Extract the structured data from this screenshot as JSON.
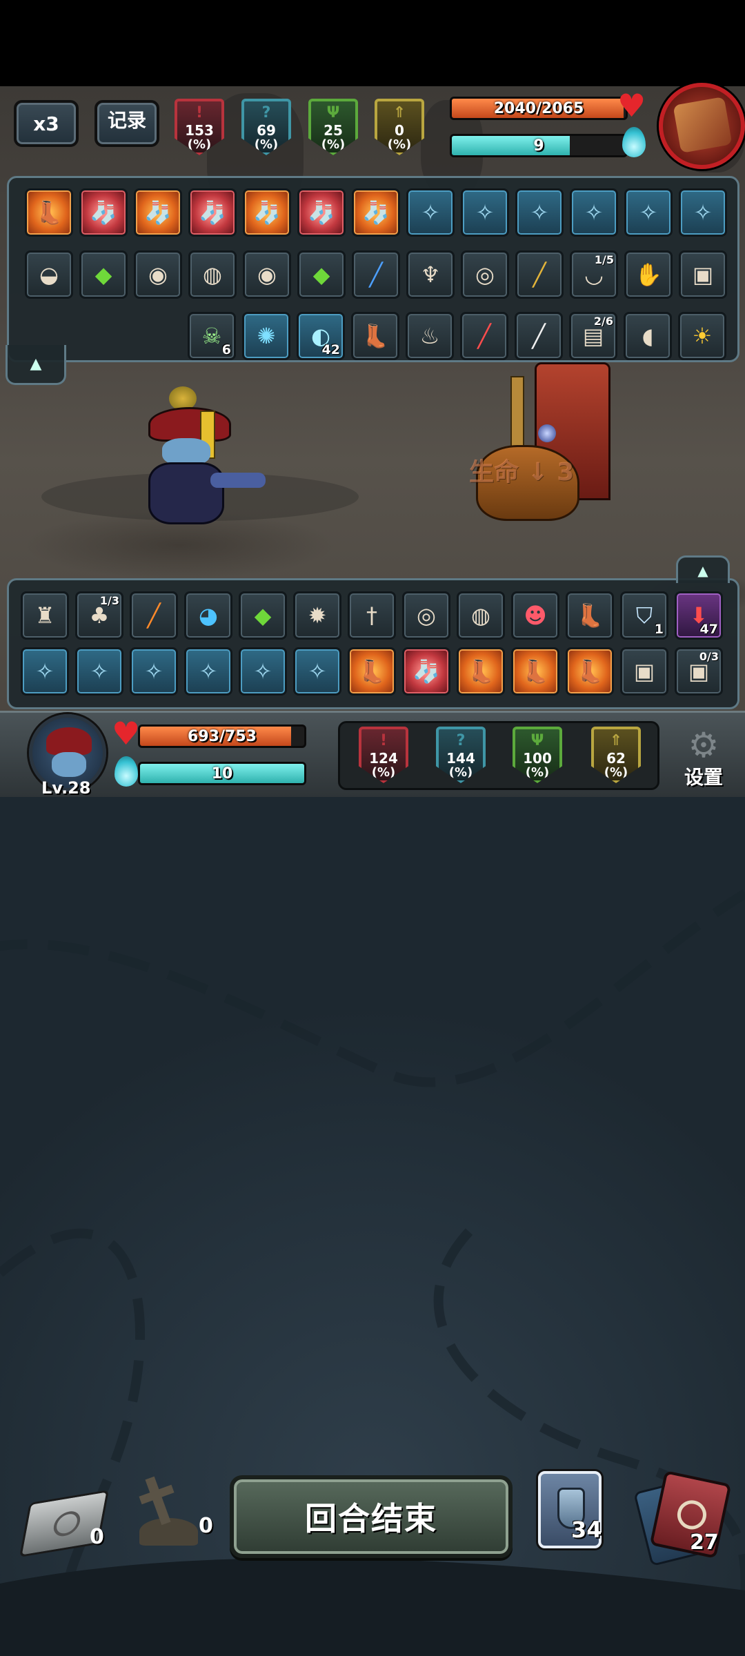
{
  "top_bar": {
    "speed_label": "x3",
    "log_label": "记录",
    "enemy_stats": [
      {
        "value": "153",
        "unit": "(%)",
        "icon": "exclamation-icon",
        "color": "#b8333d"
      },
      {
        "value": "69",
        "unit": "(%)",
        "icon": "question-icon",
        "color": "#3f96a6"
      },
      {
        "value": "25",
        "unit": "(%)",
        "icon": "trident-icon",
        "color": "#5caa3c"
      },
      {
        "value": "0",
        "unit": "(%)",
        "icon": "arrow-icon",
        "color": "#b9a640"
      }
    ],
    "enemy_hp": {
      "text": "2040/2065",
      "current": 2040,
      "max": 2065
    },
    "enemy_energy": {
      "text": "9",
      "fraction": 0.68
    }
  },
  "enemy_items": {
    "row1": [
      "boot-orange",
      "hat-red",
      "hat-orange",
      "hat-red",
      "hat-orange",
      "hat-red",
      "hat-orange",
      "skill-blue",
      "skill-blue",
      "skill-blue",
      "skill-blue",
      "skill-blue",
      "skill-blue"
    ],
    "row2": [
      {
        "icon": "sack-icon"
      },
      {
        "icon": "green-gem-icon"
      },
      {
        "icon": "shell-icon"
      },
      {
        "icon": "owl-icon"
      },
      {
        "icon": "shell-icon"
      },
      {
        "icon": "green-gem-icon"
      },
      {
        "icon": "blue-wand-icon"
      },
      {
        "icon": "brush-icon"
      },
      {
        "icon": "drum-icon"
      },
      {
        "icon": "gold-stick-icon"
      },
      {
        "icon": "bowl-icon",
        "fraction": "1/5"
      },
      {
        "icon": "glove-icon"
      },
      {
        "icon": "slot-machine-icon"
      }
    ],
    "row3": [
      {
        "icon": "skull-icon",
        "count": "6"
      },
      {
        "icon": "rune-icon"
      },
      {
        "icon": "ghost-icon",
        "count": "42"
      },
      {
        "icon": "boot-icon"
      },
      {
        "icon": "lamp-icon"
      },
      {
        "icon": "red-stick-icon"
      },
      {
        "icon": "white-stick-icon"
      },
      {
        "icon": "scroll-icon",
        "fraction": "2/6"
      },
      {
        "icon": "loaf-icon"
      },
      {
        "icon": "fire-mask-icon"
      }
    ]
  },
  "enemy_buff_text": "生命 ↓ 3",
  "player_items": {
    "row1": [
      {
        "icon": "scarecrow-icon"
      },
      {
        "icon": "plant-icon",
        "fraction": "1/3"
      },
      {
        "icon": "orange-stick-icon"
      },
      {
        "icon": "water-orb-icon"
      },
      {
        "icon": "green-gem-icon"
      },
      {
        "icon": "puffer-icon"
      },
      {
        "icon": "dagger-icon"
      },
      {
        "icon": "drum-icon"
      },
      {
        "icon": "owl-icon"
      },
      {
        "icon": "red-creature-icon"
      },
      {
        "icon": "boot-icon"
      },
      {
        "icon": "shield-icon",
        "count": "1"
      },
      {
        "icon": "down-arrow-icon",
        "count": "47"
      }
    ],
    "row2": [
      {
        "icon": "skill-icon",
        "type": "skill"
      },
      {
        "icon": "skill-icon",
        "type": "skill"
      },
      {
        "icon": "skill-icon",
        "type": "skill"
      },
      {
        "icon": "skill-icon",
        "type": "skill"
      },
      {
        "icon": "skill-icon",
        "type": "skill"
      },
      {
        "icon": "skill-icon",
        "type": "skill"
      },
      {
        "icon": "boot-icon",
        "type": "orange"
      },
      {
        "icon": "sock-icon",
        "type": "red"
      },
      {
        "icon": "boot-icon",
        "type": "orange"
      },
      {
        "icon": "boot-icon",
        "type": "orange"
      },
      {
        "icon": "boot-icon",
        "type": "orange"
      },
      {
        "icon": "slot-machine-icon",
        "type": "normal"
      },
      {
        "icon": "slot-machine-icon",
        "type": "normal",
        "fraction": "0/3"
      }
    ]
  },
  "player": {
    "level": "Lv.28",
    "hp": {
      "text": "693/753",
      "current": 693,
      "max": 753
    },
    "energy": {
      "text": "10",
      "fraction": 1.0
    },
    "stats": [
      {
        "value": "124",
        "unit": "(%)",
        "icon": "exclamation-icon",
        "color": "#b8333d"
      },
      {
        "value": "144",
        "unit": "(%)",
        "icon": "question-icon",
        "color": "#3f96a6"
      },
      {
        "value": "100",
        "unit": "(%)",
        "icon": "trident-icon",
        "color": "#5caa3c"
      },
      {
        "value": "62",
        "unit": "(%)",
        "icon": "arrow-icon",
        "color": "#b9a640"
      }
    ],
    "settings_label": "设置"
  },
  "bottom_bar": {
    "discard_count": "0",
    "grave_count": "0",
    "end_turn_label": "回合结束",
    "potion_count": "34",
    "deck_count": "27"
  }
}
